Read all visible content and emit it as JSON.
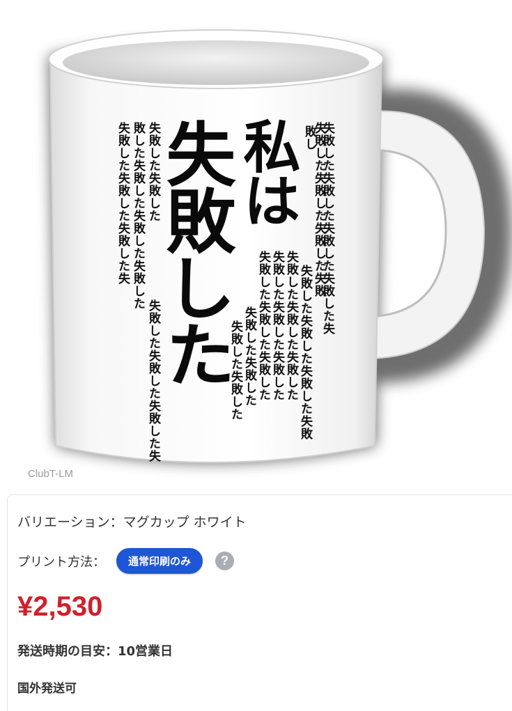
{
  "product": {
    "image": {
      "watermark": "ClubT-LM",
      "mug_color": "#ffffff",
      "print_title": "私は失敗した",
      "big_right": "私は",
      "big_left": "失敗した",
      "small_columns": [
        "失敗した失敗した失敗した失敗した失",
        "敗した失敗した失敗した失敗した",
        "失敗した失敗した失敗した失敗",
        "失敗した失敗した",
        "失敗した失敗した失敗した失敗",
        "失敗した失敗した失敗した",
        "失敗した失敗した失敗した",
        "失敗した失敗した失敗した",
        "失敗した失敗した",
        "失敗した失敗した",
        "失敗した失敗した失敗した失",
        "敗した失敗した失敗した失敗した",
        "失敗した失敗した失敗した失",
        "敗し"
      ]
    },
    "variation": "バリエーション：マグカップ ホワイト",
    "print_method_label": "プリント方法：",
    "print_method_badge": "通常印刷のみ",
    "help_icon": "?",
    "price": "¥2,530",
    "shipping_estimate": "発送時期の目安：10営業日",
    "international": "国外発送可",
    "colors": {
      "badge": "#1f56d6",
      "price": "#d21f2a",
      "help_icon": "#a9aeb6"
    }
  }
}
